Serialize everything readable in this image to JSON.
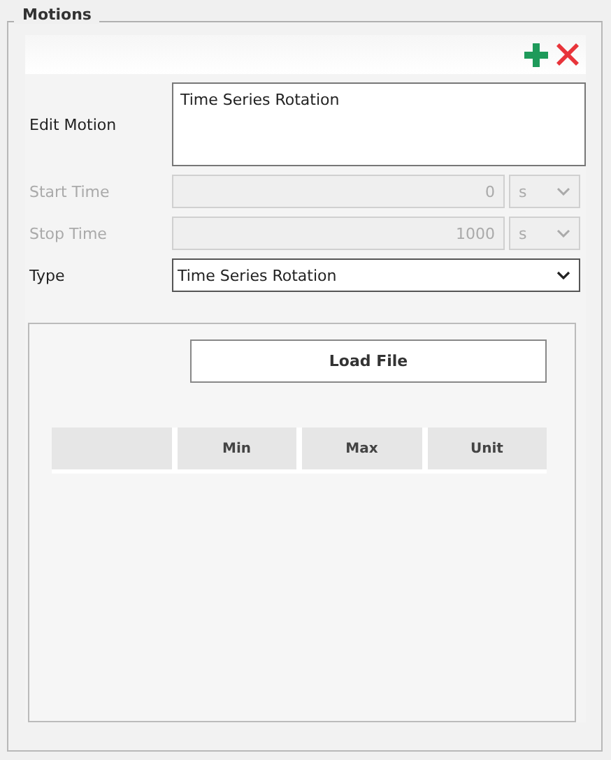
{
  "group": {
    "title": "Motions"
  },
  "toolbar": [
    {
      "kind": "add"
    },
    {
      "kind": "remove"
    }
  ],
  "fields": [
    {
      "kind": "textarea",
      "label": "Edit Motion",
      "value": "Time Series Rotation",
      "disabled": false
    },
    {
      "kind": "number",
      "label": "Start Time",
      "value": "0",
      "unit": "s",
      "disabled": true
    },
    {
      "kind": "number",
      "label": "Stop Time",
      "value": "1000",
      "unit": "s",
      "disabled": true
    },
    {
      "kind": "select",
      "label": "Type",
      "value": "Time Series Rotation",
      "disabled": false
    }
  ],
  "load_button": "Load File",
  "table": {
    "columns": [
      "Min",
      "Max",
      "Unit"
    ]
  }
}
